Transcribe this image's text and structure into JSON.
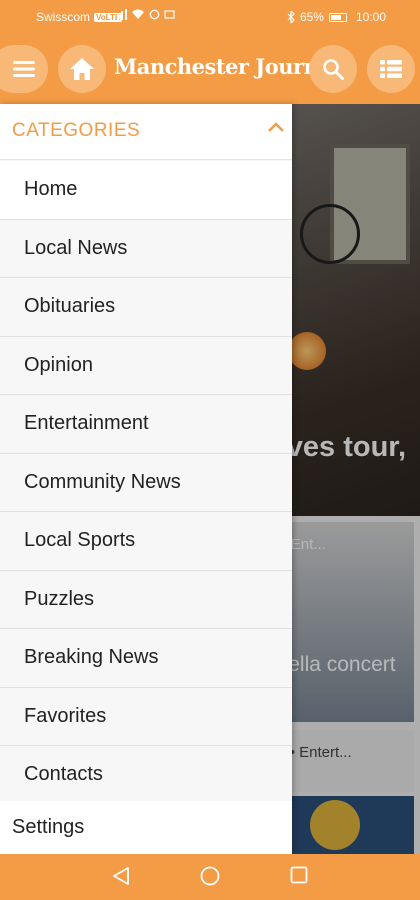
{
  "status_bar": {
    "carrier": "Swisscom",
    "volte": "VoLTE",
    "battery": "65%",
    "time": "10:00"
  },
  "header": {
    "brand": "Manchester Journal",
    "icons": [
      "menu-icon",
      "home-icon",
      "search-icon",
      "list-icon"
    ]
  },
  "background": {
    "hero_title": "Local glass artist gives tour, demo...",
    "card2_meta": "...s ago • Ent...",
    "card2_title": "A cappella concert to be...",
    "card3_meta": "...ago • Entert..."
  },
  "drawer": {
    "section_label": "CATEGORIES",
    "items": [
      {
        "label": "Home"
      },
      {
        "label": "Local News"
      },
      {
        "label": "Obituaries"
      },
      {
        "label": "Opinion"
      },
      {
        "label": "Entertainment"
      },
      {
        "label": "Community News"
      },
      {
        "label": "Local Sports"
      },
      {
        "label": "Puzzles"
      },
      {
        "label": "Breaking News"
      },
      {
        "label": "Favorites"
      },
      {
        "label": "Contacts"
      }
    ],
    "settings_label": "Settings"
  },
  "colors": {
    "accent": "#f39b45",
    "accent_light": "#f7b878"
  }
}
